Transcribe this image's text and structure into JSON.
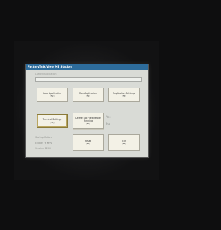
{
  "window": {
    "title": "FactoryTalk View ME Station"
  },
  "section": {
    "label": "Loaded Application:"
  },
  "buttons": {
    "load_app": {
      "label": "Load Application",
      "key": "[F1]"
    },
    "run_app": {
      "label": "Run Application",
      "key": "[F2]"
    },
    "app_settings": {
      "label": "Application Settings",
      "key": "[F3]"
    },
    "terminal_settings": {
      "label": "Terminal Settings",
      "key": "[F4]"
    },
    "delete_log": {
      "label": "Delete Log Files Before Running",
      "key": "[F5]"
    },
    "reset": {
      "label": "Reset",
      "key": "[F7]"
    },
    "exit": {
      "label": "Exit",
      "key": "[F8]"
    }
  },
  "toggles": {
    "delete_log_yes": "Yes",
    "delete_log_no": "No"
  },
  "info": {
    "startup_label": "Startup Options",
    "enable_label": "Enable F6 Keys",
    "version_label": "Version: 12.00"
  }
}
